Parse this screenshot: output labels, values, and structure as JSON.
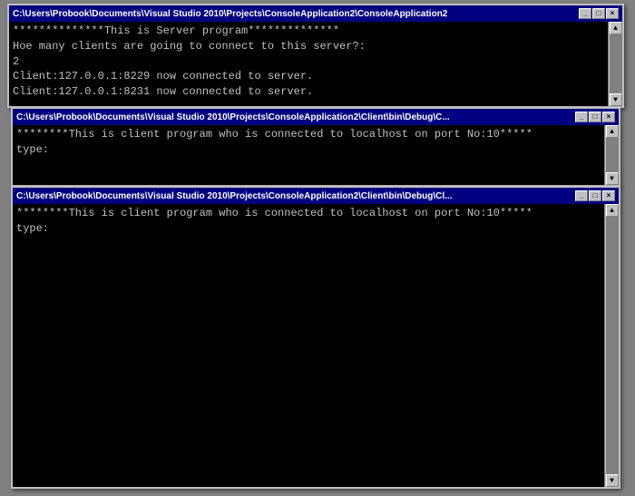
{
  "windows": {
    "server": {
      "title": "C:\\Users\\Probook\\Documents\\Visual Studio 2010\\Projects\\ConsoleApplication2\\ConsoleApplication2",
      "content": "**************This is Server program**************\nHoe many clients are going to connect to this server?:\n2\nClient:127.0.0.1:8229 now connected to server.\nClient:127.0.0.1:8231 now connected to server.",
      "buttons": {
        "minimize": "_",
        "maximize": "□",
        "close": "×"
      }
    },
    "client1": {
      "title": "C:\\Users\\Probook\\Documents\\Visual Studio 2010\\Projects\\ConsoleApplication2\\Client\\bin\\Debug\\C...",
      "content": "********This is client program who is connected to localhost on port No:10*****\ntype:",
      "buttons": {
        "minimize": "_",
        "maximize": "□",
        "close": "×"
      }
    },
    "client2": {
      "title": "C:\\Users\\Probook\\Documents\\Visual Studio 2010\\Projects\\ConsoleApplication2\\Client\\bin\\Debug\\Cl...",
      "content": "********This is client program who is connected to localhost on port No:10*****\ntype:",
      "buttons": {
        "minimize": "_",
        "maximize": "□",
        "close": "×"
      }
    }
  }
}
